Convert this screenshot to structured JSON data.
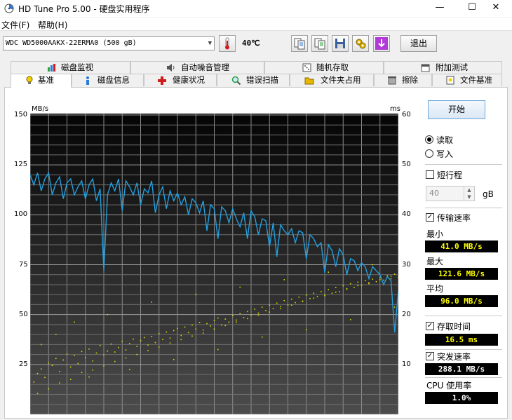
{
  "window": {
    "title": "HD Tune Pro 5.00 - 硬盘实用程序"
  },
  "menu": {
    "items": [
      "文件(F)",
      "帮助(H)"
    ]
  },
  "toolbar": {
    "drive": "WDC WD5000AAKX-22ERMA0 (500 gB)",
    "temperature": "40℃",
    "exit_label": "退出"
  },
  "tabs": {
    "row1": [
      "磁盘监视",
      "自动噪音管理",
      "随机存取",
      "附加测试"
    ],
    "row2": [
      "基准",
      "磁盘信息",
      "健康状况",
      "错误扫描",
      "文件夹占用",
      "擦除",
      "文件基准"
    ],
    "active": "基准"
  },
  "controls": {
    "start_label": "开始",
    "read_label": "读取",
    "write_label": "写入",
    "mode_selected": "读取",
    "short_stroke_label": "短行程",
    "short_stroke_checked": false,
    "short_stroke_value": "40",
    "short_stroke_unit": "gB",
    "transfer_rate_label": "传输速率",
    "transfer_rate_checked": true,
    "min_label": "最小",
    "min_value": "41.0 MB/s",
    "max_label": "最大",
    "max_value": "121.6 MB/s",
    "avg_label": "平均",
    "avg_value": "96.0 MB/s",
    "access_time_label": "存取时间",
    "access_time_checked": true,
    "access_time_value": "16.5 ms",
    "burst_rate_label": "突发速率",
    "burst_rate_checked": true,
    "burst_rate_value": "288.1 MB/s",
    "cpu_label": "CPU 使用率",
    "cpu_value": "1.0%"
  },
  "chart_data": {
    "type": "line",
    "left_axis_unit": "MB/s",
    "right_axis_unit": "ms",
    "left_ticks": [
      "150",
      "125",
      "100",
      "75",
      "50",
      "25"
    ],
    "right_ticks": [
      "60",
      "50",
      "40",
      "30",
      "20",
      "10"
    ],
    "ylim_left": [
      0,
      150
    ],
    "ylim_right": [
      0,
      60
    ],
    "x_range": [
      0,
      100
    ],
    "grid": true,
    "series": [
      {
        "kind": "line",
        "color": "#22a0e0",
        "x": [
          0,
          1,
          2,
          3,
          4,
          5,
          6,
          7,
          8,
          9,
          10,
          11,
          12,
          13,
          14,
          15,
          16,
          17,
          18,
          19,
          20,
          21,
          22,
          23,
          24,
          25,
          26,
          27,
          28,
          29,
          30,
          31,
          32,
          33,
          34,
          35,
          36,
          37,
          38,
          39,
          40,
          41,
          42,
          43,
          44,
          45,
          46,
          47,
          48,
          49,
          50,
          51,
          52,
          53,
          54,
          55,
          56,
          57,
          58,
          59,
          60,
          61,
          62,
          63,
          64,
          65,
          66,
          67,
          68,
          69,
          70,
          71,
          72,
          73,
          74,
          75,
          76,
          77,
          78,
          79,
          80,
          81,
          82,
          83,
          84,
          85,
          86,
          87,
          88,
          89,
          90,
          91,
          92,
          93,
          94,
          95,
          96,
          97,
          98,
          99,
          100
        ],
        "values": [
          120,
          115,
          121,
          112,
          118,
          121,
          110,
          116,
          119,
          108,
          116,
          118,
          110,
          114,
          117,
          108,
          115,
          118,
          107,
          113,
          72,
          110,
          116,
          112,
          118,
          102,
          117,
          114,
          110,
          116,
          105,
          113,
          111,
          117,
          101,
          110,
          114,
          103,
          112,
          107,
          111,
          105,
          109,
          100,
          108,
          106,
          101,
          107,
          92,
          105,
          103,
          88,
          104,
          102,
          96,
          103,
          98,
          94,
          101,
          88,
          102,
          99,
          90,
          98,
          97,
          84,
          96,
          79,
          95,
          92,
          90,
          93,
          86,
          92,
          91,
          78,
          90,
          88,
          84,
          86,
          71,
          85,
          82,
          74,
          83,
          80,
          70,
          78,
          77,
          72,
          76,
          74,
          68,
          74,
          72,
          70,
          65,
          69,
          67,
          41,
          62
        ]
      },
      {
        "kind": "scatter",
        "color": "#d8d800",
        "name": "存取时间",
        "x": [
          1,
          2,
          3,
          4,
          5,
          6,
          7,
          8,
          9,
          10,
          11,
          12,
          13,
          14,
          15,
          16,
          17,
          18,
          19,
          20,
          21,
          22,
          23,
          24,
          25,
          26,
          27,
          28,
          29,
          30,
          31,
          32,
          33,
          34,
          35,
          36,
          37,
          38,
          39,
          40,
          41,
          42,
          43,
          44,
          45,
          46,
          47,
          48,
          49,
          50,
          51,
          52,
          53,
          54,
          55,
          56,
          57,
          58,
          59,
          60,
          61,
          62,
          63,
          64,
          65,
          66,
          67,
          68,
          69,
          70,
          71,
          72,
          73,
          74,
          75,
          76,
          77,
          78,
          79,
          80,
          81,
          82,
          83,
          84,
          85,
          86,
          87,
          88,
          89,
          90,
          91,
          92,
          93,
          94,
          95,
          96,
          97,
          98,
          99,
          100,
          2,
          5,
          8,
          11,
          14,
          17,
          20,
          23,
          26,
          29,
          32,
          35,
          38,
          41,
          44,
          47,
          50,
          53,
          56,
          59,
          62,
          65,
          68,
          71,
          74,
          77,
          80,
          83,
          86,
          89,
          92,
          95,
          98,
          3,
          7,
          12,
          16,
          21,
          27,
          33,
          39,
          45,
          51,
          57,
          63,
          69,
          75,
          81,
          87,
          93,
          99
        ],
        "values": [
          6.5,
          8.2,
          9.1,
          7.4,
          10.3,
          9.8,
          11.2,
          8.6,
          10.9,
          12.1,
          9.5,
          11.8,
          10.2,
          12.6,
          11.4,
          13.1,
          10.7,
          12.3,
          13.8,
          11.9,
          12.7,
          14.1,
          12.5,
          13.4,
          14.6,
          12.9,
          14.2,
          15.1,
          13.6,
          14.8,
          15.4,
          13.9,
          15.6,
          14.4,
          16.2,
          15.0,
          16.5,
          15.3,
          16.8,
          17.2,
          15.8,
          17.5,
          16.4,
          17.9,
          17.1,
          18.4,
          16.9,
          18.2,
          17.7,
          18.8,
          19.3,
          17.9,
          19.1,
          18.5,
          19.8,
          18.9,
          20.2,
          19.4,
          20.6,
          19.9,
          21.1,
          20.3,
          21.5,
          20.8,
          21.9,
          21.2,
          22.3,
          21.6,
          22.8,
          21.9,
          23.1,
          22.4,
          23.5,
          22.7,
          23.9,
          23.2,
          24.3,
          23.6,
          24.6,
          23.8,
          25.0,
          24.3,
          25.4,
          24.6,
          25.8,
          25.1,
          26.2,
          25.4,
          26.5,
          25.9,
          26.8,
          26.2,
          27.1,
          26.6,
          27.4,
          26.9,
          27.8,
          27.2,
          28.1,
          27.5,
          4.2,
          5.1,
          6.3,
          7.0,
          8.4,
          8.9,
          9.7,
          10.6,
          11.3,
          12.0,
          12.8,
          13.5,
          14.3,
          15.0,
          15.7,
          16.3,
          17.1,
          17.8,
          18.5,
          19.2,
          19.9,
          20.5,
          21.2,
          21.9,
          22.6,
          23.3,
          23.9,
          24.5,
          25.2,
          25.8,
          26.4,
          27.0,
          27.7,
          14.0,
          16.0,
          18.5,
          7.5,
          20.0,
          9.0,
          22.5,
          11.0,
          24.0,
          13.0,
          25.5,
          15.5,
          27.0,
          17.0,
          28.5,
          19.0,
          30.0,
          21.5
        ]
      }
    ]
  }
}
